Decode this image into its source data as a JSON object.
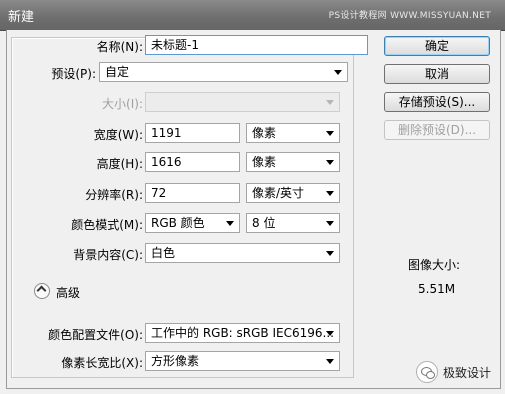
{
  "window": {
    "title": "新建",
    "watermark": "PS设计教程网  WWW.MISSYUAN.NET"
  },
  "form": {
    "name": {
      "label": "名称(N):",
      "value": "未标题-1"
    },
    "preset": {
      "label": "预设(P):",
      "value": "自定"
    },
    "size": {
      "label": "大小(I):",
      "value": ""
    },
    "width": {
      "label": "宽度(W):",
      "value": "1191",
      "unit": "像素"
    },
    "height": {
      "label": "高度(H):",
      "value": "1616",
      "unit": "像素"
    },
    "resolution": {
      "label": "分辨率(R):",
      "value": "72",
      "unit": "像素/英寸"
    },
    "color_mode": {
      "label": "颜色模式(M):",
      "value": "RGB 颜色",
      "depth": "8 位"
    },
    "background": {
      "label": "背景内容(C):",
      "value": "白色"
    },
    "advanced": {
      "label": "高级"
    },
    "color_profile": {
      "label": "颜色配置文件(O):",
      "value": "工作中的 RGB: sRGB IEC6196..."
    },
    "pixel_aspect": {
      "label": "像素长宽比(X):",
      "value": "方形像素"
    }
  },
  "buttons": {
    "ok": "确定",
    "cancel": "取消",
    "save_preset": "存储预设(S)...",
    "delete_preset": "删除预设(D)..."
  },
  "image_size": {
    "label": "图像大小:",
    "value": "5.51M"
  },
  "footer": {
    "brand": "极致设计"
  },
  "colors": {
    "titlebar": "#777777",
    "focus_border": "#5b9bd5",
    "default_button": "#3c7fb1"
  },
  "icons": {
    "advanced_toggle": "chevron-up-icon",
    "brand": "wechat-icon"
  }
}
